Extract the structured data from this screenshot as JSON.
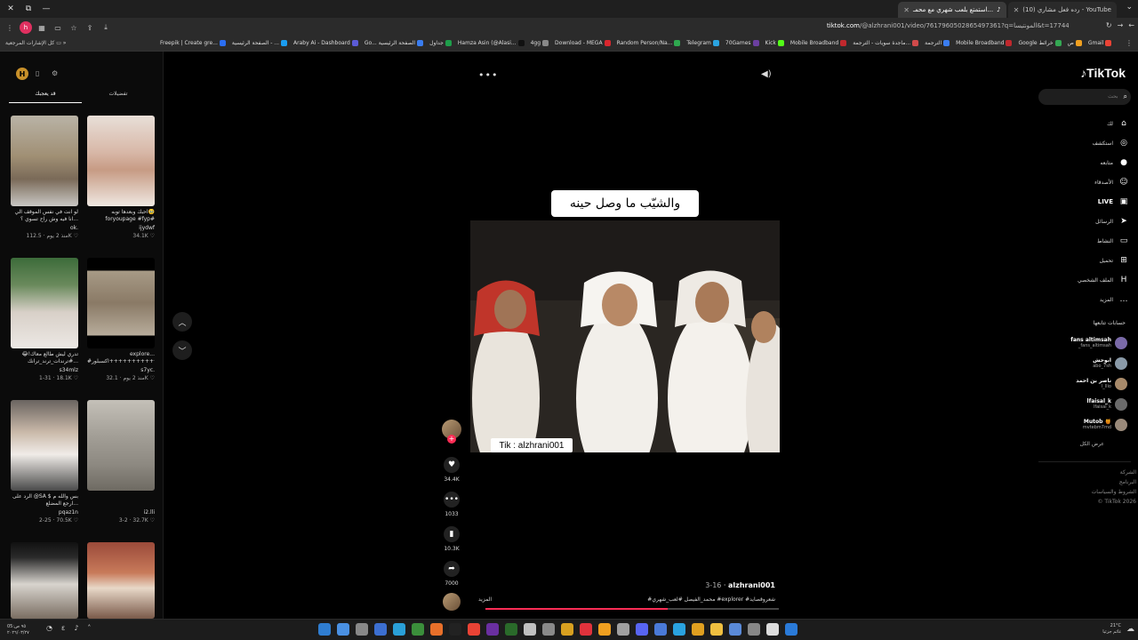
{
  "browser": {
    "tabs": [
      {
        "title": "استمتع بلعب شهري مع محمـ...",
        "active": true
      },
      {
        "title": "(10) رده فعل مشاري - YouTube",
        "active": false
      }
    ],
    "url_domain": "tiktok.com",
    "url_path": "/@alzhrani001/video/7617960502865497361?q=المونتيسا&t=1774417470806",
    "bookmarks_left": "كل الإشارات المرجعية",
    "bookmarks": [
      {
        "label": "Freepik | Create gre...",
        "color": "#2b6ef2"
      },
      {
        "label": "الصفحة الرئيسية - ...",
        "color": "#1a9cf0"
      },
      {
        "label": "Araby Ai - Dashboard",
        "color": "#5b5bd6"
      },
      {
        "label": "Go... الصفحة الرئيسية",
        "color": "#3a7df0"
      },
      {
        "label": "جداول",
        "color": "#1e9e4a"
      },
      {
        "label": "Hamza Asin (@Alasi...",
        "color": "#111111"
      },
      {
        "label": "4gg",
        "color": "#888888"
      },
      {
        "label": "Download - MEGA",
        "color": "#d9272e"
      },
      {
        "label": "Random Person/Na...",
        "color": "#2fa84f"
      },
      {
        "label": "Telegram",
        "color": "#2aa3e0"
      },
      {
        "label": "70Games",
        "color": "#6b3fa0"
      },
      {
        "label": "Kick",
        "color": "#53fc18"
      },
      {
        "label": "Mobile Broadband",
        "color": "#c0282d"
      },
      {
        "label": "ماجدة سويات - الترجمة...",
        "color": "#d04a4a"
      },
      {
        "label": "الترجمة",
        "color": "#3a7df0"
      },
      {
        "label": "Mobile Broadband",
        "color": "#c0282d"
      },
      {
        "label": "Google خرائط",
        "color": "#34a853"
      },
      {
        "label": "ص",
        "color": "#f0a020"
      },
      {
        "label": "Gmail",
        "color": "#ea4335"
      }
    ]
  },
  "left_panel": {
    "tabs": [
      "قد يعجبك",
      "تفضيلات"
    ],
    "videos": [
      {
        "title": "لو انت في نفس الموقف الي انا فيه وش راح تسوي ؟...",
        "user": "ok.",
        "views": "112.5K",
        "ago": "منذ 2 يوم"
      },
      {
        "title": "احبك وبعدها توبه🥹 foryoupage #fyp#",
        "user": "ijydwf",
        "views": "34.1K",
        "ago": ""
      },
      {
        "title": "تدري ليش طالع معاك!😂 #ترندات_ترند_ترانك...",
        "user": "s34mlz",
        "views": "18.1K",
        "ago": "1-31"
      },
      {
        "title": "explore... #اكسبلور++++++++++++",
        "user": "s7yc.",
        "views": "32.1K",
        "ago": "منذ 2 يوم"
      },
      {
        "title": "الرد على @SA $ بس والله م ارجع المضلع...",
        "user": "pqaz1n",
        "views": "70.5K",
        "ago": "2-25"
      },
      {
        "title": "",
        "user": "i2.lli",
        "views": "32.7K",
        "ago": "3-2"
      }
    ]
  },
  "main": {
    "caption": "والشيّب ما وصل حينه",
    "watermark": "Tik : alzhrani001",
    "likes": "34.4K",
    "comments": "1033",
    "saves": "10.3K",
    "shares": "7000",
    "author": "alzhrani001",
    "date": "3-16",
    "hashtags": "#محمد_الفيصل #لعب_شهري #explorer #شعروقصايد",
    "more": "المزيد",
    "progress": 0.62
  },
  "sidebar": {
    "logo": "TikTok",
    "search_placeholder": "بحث",
    "nav": [
      {
        "label": "لك",
        "icon": "⌂"
      },
      {
        "label": "استكشف",
        "icon": "◎"
      },
      {
        "label": "متابعه",
        "icon": "●"
      },
      {
        "label": "الأصدقاء",
        "icon": "☺"
      },
      {
        "label": "LIVE",
        "icon": "▣"
      },
      {
        "label": "الرسائل",
        "icon": "➤"
      },
      {
        "label": "النشاط",
        "icon": "▭"
      },
      {
        "label": "تحميل",
        "icon": "⊞"
      },
      {
        "label": "الملف الشخصي",
        "icon": "H"
      },
      {
        "label": "المزيد",
        "icon": "…"
      }
    ],
    "following_title": "حسابات تتابعها",
    "following": [
      {
        "name": "fans altimsah",
        "handle": "_fans_altimsah"
      },
      {
        "name": "ابوحش",
        "handle": "abo_7sh"
      },
      {
        "name": "ناصر بن احمد",
        "handle": "l_llio"
      },
      {
        "name": "lfaisal_k",
        "handle": "lfaisal_k"
      },
      {
        "name": "Mutob 🍯",
        "handle": "mvtebm7md"
      }
    ],
    "see_all": "عرض الكل",
    "footer": [
      "الشركة",
      "البرنامج",
      "الشروط والسياسات",
      "© TikTok 2026"
    ]
  },
  "taskbar": {
    "time": "05:٩٥ ص",
    "date": "٢٠٢٦/٠٣/٢٧",
    "weather": "21°C",
    "weather_desc": "غائم جزئيا"
  }
}
